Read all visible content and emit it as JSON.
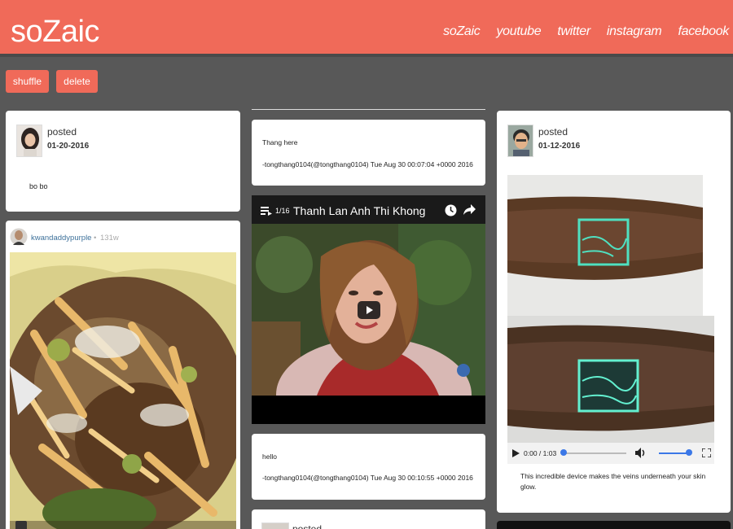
{
  "header": {
    "brand": "soZaic",
    "nav": [
      "soZaic",
      "youtube",
      "twitter",
      "instagram",
      "facebook"
    ]
  },
  "toolbar": {
    "shuffle_label": "shuffle",
    "delete_label": "delete"
  },
  "col1": {
    "post1": {
      "title": "posted",
      "date": "01-20-2016",
      "body": "bo bo"
    },
    "instagram": {
      "user": "kwandaddypurple",
      "age": "131w"
    }
  },
  "col2": {
    "tweet1": {
      "text": "Thang here",
      "meta": "-tongthang0104(@tongthang0104) Tue Aug 30 00:07:04 +0000 2016"
    },
    "video": {
      "counter": "1/16",
      "title": "Thanh Lan Anh Thi Khong"
    },
    "tweet2": {
      "text": "hello",
      "meta": "-tongthang0104(@tongthang0104) Tue Aug 30 00:10:55 +0000 2016"
    },
    "post2": {
      "title": "posted"
    }
  },
  "col3": {
    "post": {
      "title": "posted",
      "date": "01-12-2016"
    },
    "video": {
      "time": "0:00 / 1:03",
      "caption": "This incredible device makes the veins underneath your skin glow."
    }
  },
  "colors": {
    "accent": "#f06a59",
    "background": "#585858"
  }
}
